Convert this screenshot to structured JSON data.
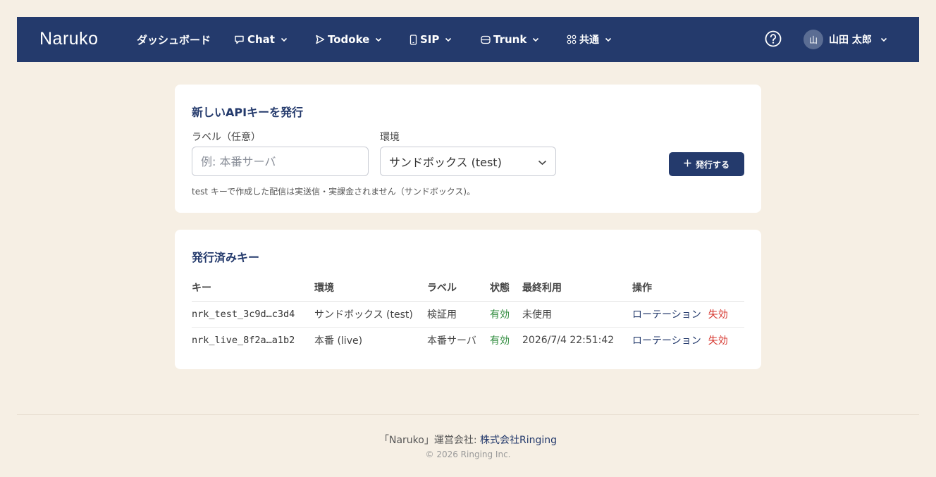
{
  "nav": {
    "brand": "Naruko",
    "dashboard": "ダッシュボード",
    "chat": "Chat",
    "todoke": "Todoke",
    "sip": "SIP",
    "trunk": "Trunk",
    "common": "共通",
    "user_initial": "山",
    "user_name": "山田 太郎"
  },
  "issue_form": {
    "title": "新しいAPIキーを発行",
    "label_field_label": "ラベル（任意）",
    "label_placeholder": "例: 本番サーバ",
    "env_field_label": "環境",
    "env_selected": "サンドボックス (test)",
    "issue_button": "発行する",
    "hint": "test キーで作成した配信は実送信・実課金されません（サンドボックス)。"
  },
  "keys": {
    "title": "発行済みキー",
    "columns": [
      "キー",
      "環境",
      "ラベル",
      "状態",
      "最終利用",
      "操作"
    ],
    "rows": [
      {
        "key": "nrk_test_3c9d…c3d4",
        "env": "サンドボックス (test)",
        "label": "検証用",
        "status": "有効",
        "last_used": "未使用",
        "rotate": "ローテーション",
        "revoke": "失効"
      },
      {
        "key": "nrk_live_8f2a…a1b2",
        "env": "本番 (live)",
        "label": "本番サーバ",
        "status": "有効",
        "last_used": "2026/7/4 22:51:42",
        "rotate": "ローテーション",
        "revoke": "失効"
      }
    ]
  },
  "footer": {
    "prefix": "「Naruko」運営会社: ",
    "company": "株式会社Ringing",
    "copyright": "© 2026 Ringing Inc."
  },
  "colors": {
    "nav_bg": "#243a6c",
    "page_bg": "#f6efe4",
    "status_ok": "#2e8b3c",
    "danger": "#d6342c"
  }
}
